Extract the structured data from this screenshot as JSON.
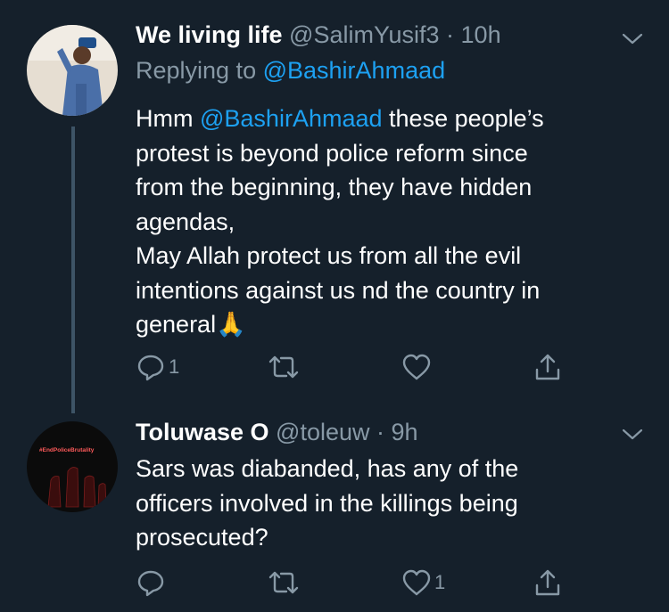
{
  "tweets": [
    {
      "name": "We living life",
      "handle": "@SalimYusif3",
      "time": "· 10h",
      "replying_prefix": "Replying to",
      "replying_handle": "@BashirAhmaad",
      "body": {
        "line1_prefix": "Hmm",
        "line1_mention": "@BashirAhmaad",
        "line1_suffix": "these people’s",
        "line2": "protest is beyond police reform since",
        "line3": "from the beginning, they have hidden",
        "line4": "agendas,",
        "line5": "May Allah protect us from all the evil",
        "line6": "intentions against us nd the country in",
        "line7": "general",
        "emoji": "🙏"
      },
      "reply_count": "1",
      "retweet_count": "",
      "like_count": ""
    },
    {
      "name": "Toluwase O",
      "handle": "@toleuw",
      "time": "· 9h",
      "avatar_text": "#EndPoliceBrutality",
      "body": {
        "line1": "Sars was diabanded, has any of the",
        "line2": "officers involved in the killings being",
        "line3": "prosecuted?"
      },
      "reply_count": "",
      "retweet_count": "",
      "like_count": "1"
    }
  ],
  "icons": [
    "reply-icon",
    "retweet-icon",
    "like-icon",
    "share-icon",
    "chevron-down-icon"
  ],
  "colors": {
    "background": "#15202b",
    "link": "#1da1f2",
    "muted": "#8899a6",
    "thread": "#3d5466"
  }
}
